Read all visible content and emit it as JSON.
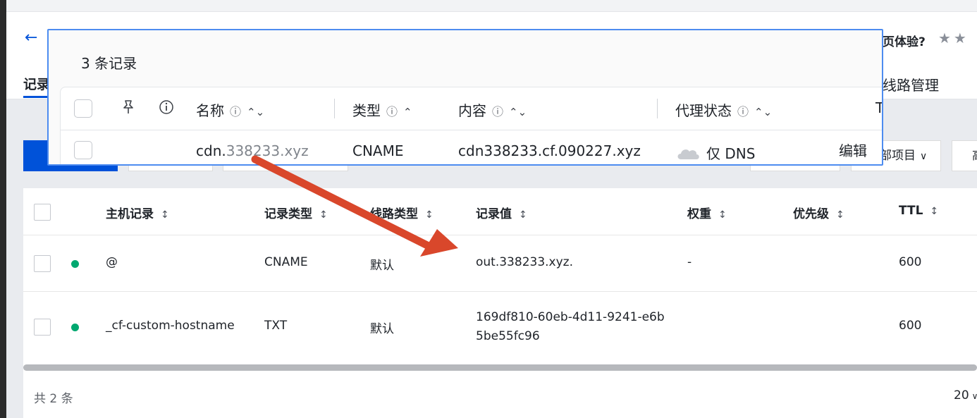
{
  "header": {
    "back_icon": "arrow-left-icon",
    "tab_records": "记录",
    "tab_line_mgmt": "线路管理",
    "survey_text": "页体验?",
    "stars": "★★"
  },
  "toolbar": {
    "dropdown_label": "部项目",
    "adv_label": "高"
  },
  "table": {
    "columns": [
      "主机记录",
      "记录类型",
      "线路类型",
      "记录值",
      "权重",
      "优先级",
      "TTL"
    ],
    "rows": [
      {
        "host": "@",
        "type": "CNAME",
        "line": "默认",
        "value": "out.338233.xyz.",
        "weight": "-",
        "priority": "",
        "ttl": "600"
      },
      {
        "host": "_cf-custom-hostname",
        "type": "TXT",
        "line": "默认",
        "value": "169df810-60eb-4d11-9241-e6b5be55fc96",
        "weight": "",
        "priority": "",
        "ttl": "600"
      }
    ],
    "total": "共 2 条",
    "page_size": "20"
  },
  "popup": {
    "count": "3 条记录",
    "columns": {
      "name": "名称",
      "type": "类型",
      "content": "内容",
      "proxy": "代理状态",
      "ttl": "T"
    },
    "row": {
      "name_main": "cdn.",
      "name_domain": "338233.xyz",
      "type": "CNAME",
      "content": "cdn338233.cf.090227.xyz",
      "proxy": "仅 DNS",
      "edit": "编辑"
    }
  },
  "colors": {
    "accent": "#0052d9",
    "status_green": "#00a870",
    "arrow_red": "#d9472b",
    "popup_border": "#4d8cf0"
  }
}
